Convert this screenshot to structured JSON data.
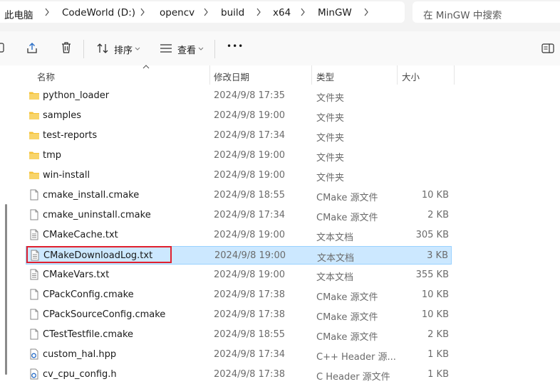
{
  "breadcrumb": [
    "此电脑",
    "CodeWorld (D:)",
    "opencv",
    "build",
    "x64",
    "MinGW"
  ],
  "search": {
    "placeholder": "在 MinGW 中搜索"
  },
  "toolbar": {
    "sort_label": "排序",
    "view_label": "查看",
    "more_label": "•••"
  },
  "columns": {
    "name": "名称",
    "date": "修改日期",
    "type": "类型",
    "size": "大小"
  },
  "files": [
    {
      "name": "python_loader",
      "date": "2024/9/8 17:35",
      "type": "文件夹",
      "size": "",
      "icon": "folder-icon"
    },
    {
      "name": "samples",
      "date": "2024/9/8 19:00",
      "type": "文件夹",
      "size": "",
      "icon": "folder-icon"
    },
    {
      "name": "test-reports",
      "date": "2024/9/8 17:34",
      "type": "文件夹",
      "size": "",
      "icon": "folder-icon"
    },
    {
      "name": "tmp",
      "date": "2024/9/8 19:00",
      "type": "文件夹",
      "size": "",
      "icon": "folder-icon"
    },
    {
      "name": "win-install",
      "date": "2024/9/8 19:00",
      "type": "文件夹",
      "size": "",
      "icon": "folder-icon"
    },
    {
      "name": "cmake_install.cmake",
      "date": "2024/9/8 18:55",
      "type": "CMake 源文件",
      "size": "10 KB",
      "icon": "file-icon"
    },
    {
      "name": "cmake_uninstall.cmake",
      "date": "2024/9/8 17:34",
      "type": "CMake 源文件",
      "size": "2 KB",
      "icon": "file-icon"
    },
    {
      "name": "CMakeCache.txt",
      "date": "2024/9/8 19:00",
      "type": "文本文档",
      "size": "305 KB",
      "icon": "text-file-icon"
    },
    {
      "name": "CMakeDownloadLog.txt",
      "date": "2024/9/8 19:00",
      "type": "文本文档",
      "size": "3 KB",
      "icon": "text-file-icon",
      "selected": true
    },
    {
      "name": "CMakeVars.txt",
      "date": "2024/9/8 19:00",
      "type": "文本文档",
      "size": "355 KB",
      "icon": "text-file-icon"
    },
    {
      "name": "CPackConfig.cmake",
      "date": "2024/9/8 17:38",
      "type": "CMake 源文件",
      "size": "10 KB",
      "icon": "file-icon"
    },
    {
      "name": "CPackSourceConfig.cmake",
      "date": "2024/9/8 17:38",
      "type": "CMake 源文件",
      "size": "10 KB",
      "icon": "file-icon"
    },
    {
      "name": "CTestTestfile.cmake",
      "date": "2024/9/8 18:55",
      "type": "CMake 源文件",
      "size": "2 KB",
      "icon": "file-icon"
    },
    {
      "name": "custom_hal.hpp",
      "date": "2024/9/8 17:34",
      "type": "C++ Header 源...",
      "size": "1 KB",
      "icon": "cpp-header-icon"
    },
    {
      "name": "cv_cpu_config.h",
      "date": "2024/9/8 17:38",
      "type": "C Header 源文件",
      "size": "1 KB",
      "icon": "c-header-icon"
    }
  ],
  "colors": {
    "selection": "#cce8ff",
    "selection_border": "#99d1ff",
    "highlight_box": "#e0202e",
    "folder": "#f4c23b"
  }
}
